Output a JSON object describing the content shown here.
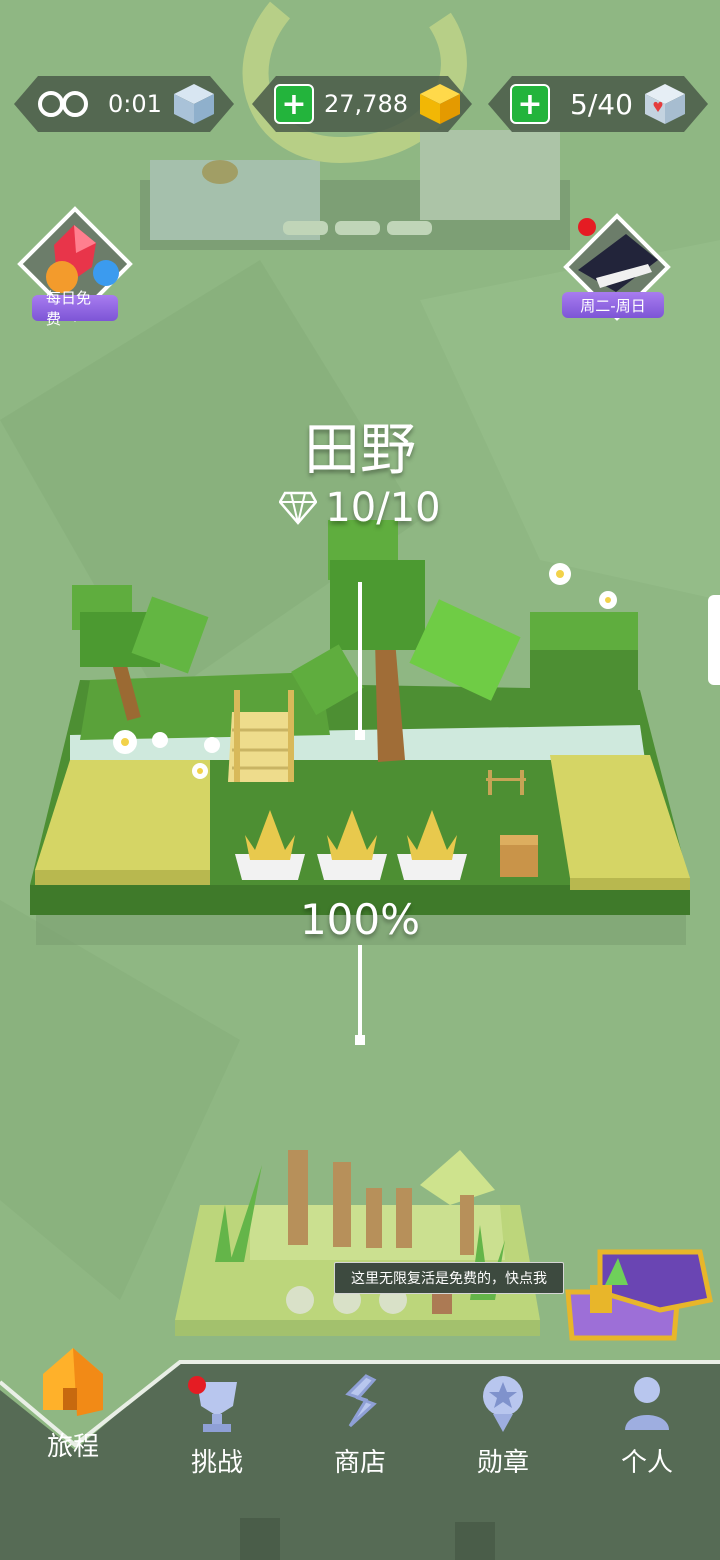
{
  "status_bar": {
    "lives_icon": "infinity-icon",
    "lives_timer": "0:01",
    "lives_cube_icon": "ice-cube-icon",
    "gems_value": "27,788",
    "gems_icon": "gold-cube-icon",
    "hearts_value": "5/40",
    "hearts_icon": "heart-cube-icon"
  },
  "side_buttons": {
    "daily_free_label": "每日免费",
    "weekday_label": "周二-周日"
  },
  "level": {
    "name": "田野",
    "diamonds": "10/10",
    "progress": "100%",
    "crowns_earned": 3
  },
  "tooltip": {
    "text": "这里无限复活是免费的，快点我"
  },
  "nav": {
    "items": [
      {
        "label": "旅程",
        "icon": "home-icon"
      },
      {
        "label": "挑战",
        "icon": "trophy-icon"
      },
      {
        "label": "商店",
        "icon": "shop-icon"
      },
      {
        "label": "勋章",
        "icon": "medal-icon"
      },
      {
        "label": "个人",
        "icon": "person-icon"
      }
    ]
  },
  "colors": {
    "background": "#8fb783",
    "nav_bg": "#566b55",
    "accent_green": "#23b43c",
    "gold": "#f2b705",
    "purple_label": "#8a5fe0"
  }
}
